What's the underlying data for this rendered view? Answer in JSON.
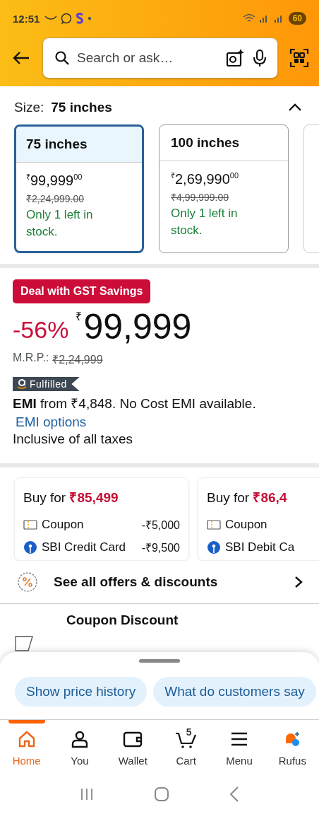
{
  "status_bar": {
    "time": "12:51",
    "battery": "60"
  },
  "search": {
    "placeholder": "Search or ask…"
  },
  "size": {
    "label": "Size:",
    "value": "75 inches",
    "expanded": true
  },
  "sizes": [
    {
      "name": "75 inches",
      "currency": "₹",
      "price": "99,999",
      "fraction": "00",
      "mrp": "₹2,24,999.00",
      "stock": "Only 1 left in stock.",
      "selected": true
    },
    {
      "name": "100 inches",
      "currency": "₹",
      "price": "2,69,990",
      "fraction": "00",
      "mrp": "₹4,99,999.00",
      "stock": "Only 1 left in stock.",
      "selected": false
    }
  ],
  "deal_badge": "Deal with GST Savings",
  "price": {
    "discount": "-56%",
    "currency": "₹",
    "amount": "99,999",
    "mrp_label": "M.R.P.:",
    "mrp": "₹2,24,999"
  },
  "fulfilled_badge": "Fulfilled",
  "emi": "**EMI** from ₹4,848. No Cost EMI available.",
  "emi_link": "EMI options",
  "tax_note": "Inclusive of all taxes",
  "offers": [
    {
      "title": "Buy for",
      "price": "₹85,499",
      "lines": [
        {
          "kind": "coupon",
          "label": "Coupon",
          "amount": "-₹5,000"
        },
        {
          "kind": "bank",
          "label": "SBI Credit Card",
          "amount": "-₹9,500"
        }
      ]
    },
    {
      "title": "Buy for",
      "price": "₹86,4",
      "lines": [
        {
          "kind": "coupon",
          "label": "Coupon"
        },
        {
          "kind": "bank",
          "label": "SBI Debit Ca"
        }
      ]
    }
  ],
  "all_offers": "See all offers & discounts",
  "coupon": {
    "title": "Coupon Discount"
  },
  "chips": [
    "Show price history",
    "What do customers say"
  ],
  "nav": [
    {
      "kind": "home",
      "label": "Home",
      "selected": true
    },
    {
      "kind": "you",
      "label": "You",
      "selected": false
    },
    {
      "kind": "wallet",
      "label": "Wallet",
      "selected": false
    },
    {
      "kind": "cart",
      "label": "Cart",
      "badge": "5",
      "selected": false
    },
    {
      "kind": "menu",
      "label": "Menu",
      "selected": false
    },
    {
      "kind": "rufus",
      "label": "Rufus",
      "selected": false
    }
  ]
}
